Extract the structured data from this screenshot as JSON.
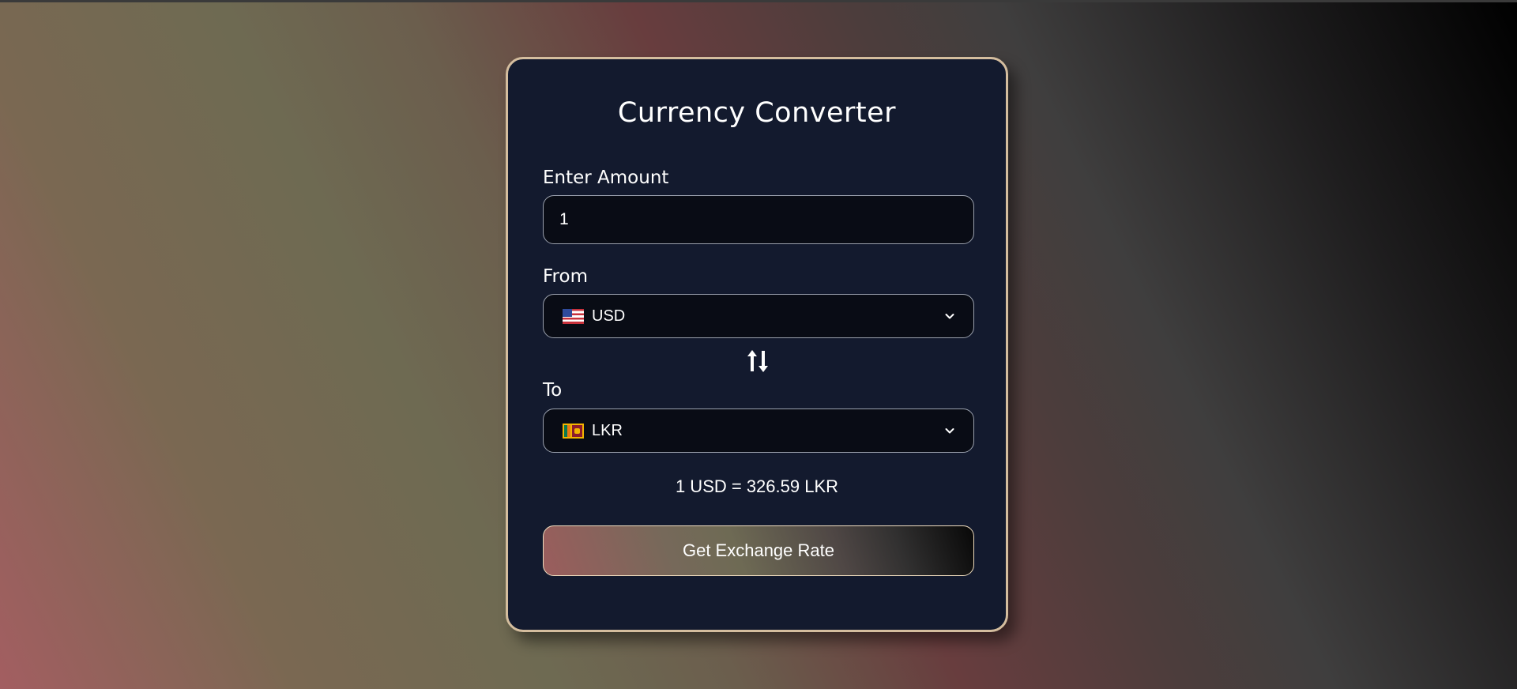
{
  "converter": {
    "title": "Currency Converter",
    "amount_label": "Enter Amount",
    "amount_value": "1",
    "from_label": "From",
    "from_currency": "USD",
    "from_flag": "us-flag-icon",
    "to_label": "To",
    "to_currency": "LKR",
    "to_flag": "lk-flag-icon",
    "swap_icon": "swap-arrows-icon",
    "dropdown_icon": "chevron-down-icon",
    "rate_text": "1 USD = 326.59 LKR",
    "button_label": "Get Exchange Rate"
  },
  "colors": {
    "card_background": "#131a2e",
    "card_border": "#d4bd9e",
    "field_background": "#090c15",
    "field_border": "#9aa0ad",
    "button_border": "#efdcbe",
    "text": "#ffffff"
  }
}
